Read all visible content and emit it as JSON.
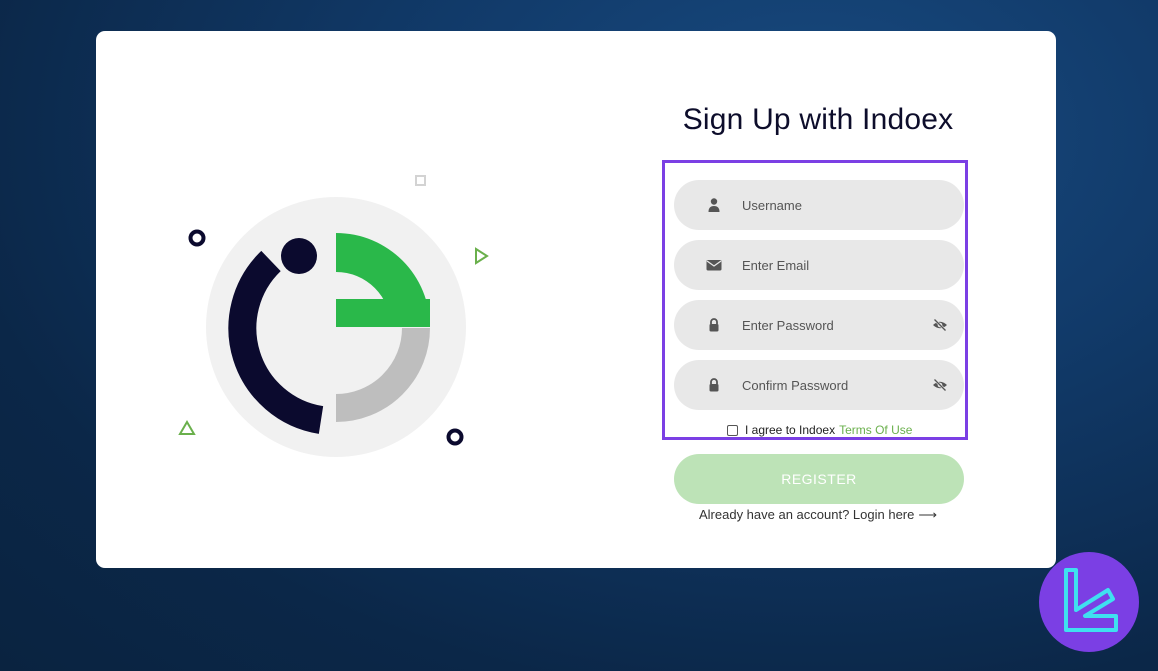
{
  "signup": {
    "title": "Sign Up with Indoex",
    "fields": [
      {
        "placeholder": "Username",
        "icon": "user-icon"
      },
      {
        "placeholder": "Enter Email",
        "icon": "envelope-icon"
      },
      {
        "placeholder": "Enter Password",
        "icon": "lock-icon",
        "toggle_icon": "eye-slash-icon"
      },
      {
        "placeholder": "Confirm Password",
        "icon": "lock-icon",
        "toggle_icon": "eye-slash-icon"
      }
    ],
    "terms_prefix": "I agree to Indoex",
    "terms_link": "Terms Of Use",
    "register_label": "REGISTER",
    "login_prompt": "Already have an account? Login here",
    "login_arrow": "⟶"
  },
  "colors": {
    "accent_green": "#2ab84a",
    "dark_navy": "#0b0a2e",
    "highlight_purple": "#7b3fe4",
    "register_disabled": "#bde3b7",
    "background_blue": "#113a69"
  }
}
